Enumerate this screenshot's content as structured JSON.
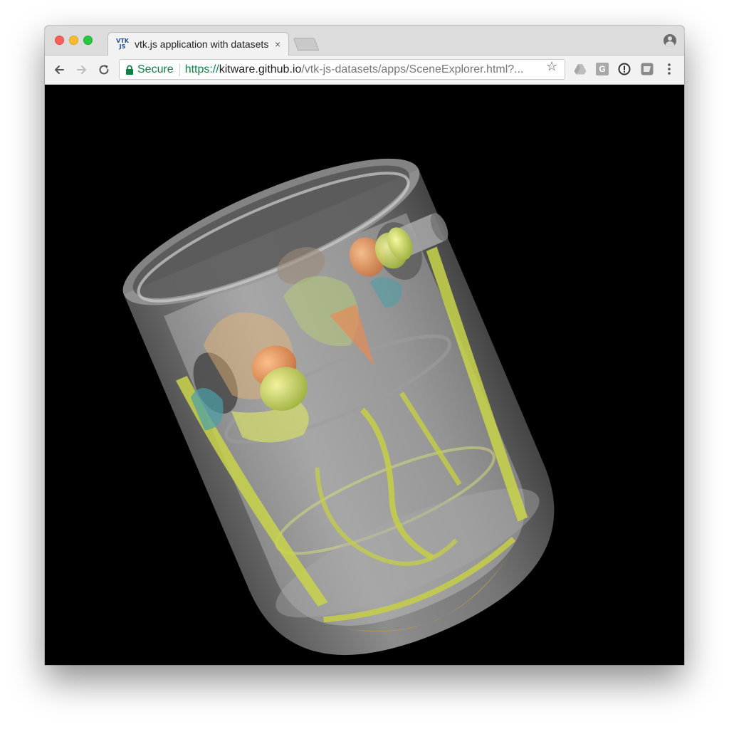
{
  "tab": {
    "favicon_top": "VTK",
    "favicon_bottom": "JS",
    "title": "vtk.js application with datasets",
    "close_symbol": "×"
  },
  "address_bar": {
    "security_label": "Secure",
    "url_scheme": "https://",
    "url_host": "kitware.github.io",
    "url_path": "/vtk-js-datasets/apps/SceneExplorer.html?...",
    "bookmark_symbol": "☆"
  },
  "extensions": {
    "g_label": "G"
  },
  "icons": [
    "back-icon",
    "forward-icon",
    "reload-icon",
    "lock-icon",
    "star-icon",
    "drive-icon",
    "g-extension-icon",
    "info-extension-icon",
    "extension-icon",
    "menu-icon",
    "profile-icon"
  ],
  "colors": {
    "secure_green": "#0b8043",
    "viewport_background": "#000000",
    "titlebar": "#dcdcdc",
    "toolbar": "#f2f2f2"
  }
}
